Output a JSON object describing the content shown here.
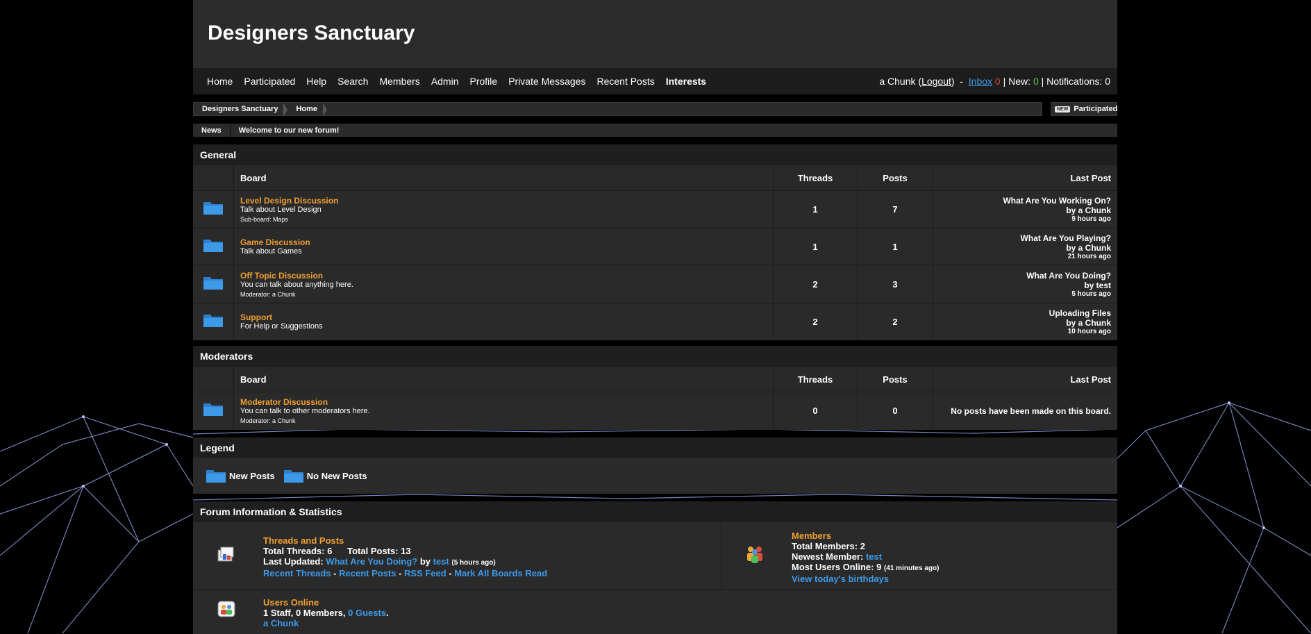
{
  "site": {
    "title": "Designers Sanctuary"
  },
  "nav": {
    "items": [
      "Home",
      "Participated",
      "Help",
      "Search",
      "Members",
      "Admin",
      "Profile",
      "Private Messages",
      "Recent Posts",
      "Interests"
    ]
  },
  "user": {
    "name": "a Chunk",
    "logout": "Logout",
    "inbox_label": "Inbox",
    "inbox_count": "0",
    "new_label": "New:",
    "new_count": "0",
    "notifications_label": "Notifications:",
    "notifications_count": "0"
  },
  "breadcrumb": [
    "Designers Sanctuary",
    "Home"
  ],
  "participated_button": {
    "tag": "NEW",
    "label": "Participated"
  },
  "news": {
    "label": "News",
    "text": "Welcome to our new forum!"
  },
  "general": {
    "title": "General",
    "headers": {
      "board": "Board",
      "threads": "Threads",
      "posts": "Posts",
      "last": "Last Post"
    },
    "boards": [
      {
        "name": "Level Design Discussion",
        "desc": "Talk about Level Design",
        "sub": "Sub-board: Maps",
        "threads": "1",
        "posts": "7",
        "last_title": "What Are You Working On?",
        "last_by": "by a Chunk",
        "last_time": "9 hours ago"
      },
      {
        "name": "Game Discussion",
        "desc": "Talk about Games",
        "sub": "",
        "threads": "1",
        "posts": "1",
        "last_title": "What Are You Playing?",
        "last_by": "by a Chunk",
        "last_time": "21 hours ago"
      },
      {
        "name": "Off Topic Discussion",
        "desc": "You can talk about anything here.",
        "sub": "Moderator: a Chunk",
        "threads": "2",
        "posts": "3",
        "last_title": "What Are You Doing?",
        "last_by": "by test",
        "last_time": "5 hours ago"
      },
      {
        "name": "Support",
        "desc": "For Help or Suggestions",
        "sub": "",
        "threads": "2",
        "posts": "2",
        "last_title": "Uploading Files",
        "last_by": "by a Chunk",
        "last_time": "10 hours ago"
      }
    ]
  },
  "moderators": {
    "title": "Moderators",
    "headers": {
      "board": "Board",
      "threads": "Threads",
      "posts": "Posts",
      "last": "Last Post"
    },
    "boards": [
      {
        "name": "Moderator Discussion",
        "desc": "You can talk to other moderators here.",
        "sub": "Moderator: a Chunk",
        "threads": "0",
        "posts": "0",
        "last_text": "No posts have been made on this board."
      }
    ]
  },
  "legend": {
    "title": "Legend",
    "new_posts": "New Posts",
    "no_new_posts": "No New Posts"
  },
  "stats": {
    "title": "Forum Information & Statistics",
    "threads_posts": {
      "heading": "Threads and Posts",
      "total_threads_label": "Total Threads:",
      "total_threads": "6",
      "total_posts_label": "Total Posts:",
      "total_posts": "13",
      "last_updated_label": "Last Updated:",
      "last_updated_thread": "What Are You Doing?",
      "by": "by",
      "last_updated_user": "test",
      "last_updated_time": "(5 hours ago)",
      "links": [
        "Recent Threads",
        "Recent Posts",
        "RSS Feed",
        "Mark All Boards Read"
      ]
    },
    "members": {
      "heading": "Members",
      "total_label": "Total Members:",
      "total": "2",
      "newest_label": "Newest Member:",
      "newest": "test",
      "most_online_label": "Most Users Online:",
      "most_online": "9",
      "most_online_time": "(41 minutes ago)",
      "birthdays": "View today's birthdays"
    },
    "online": {
      "heading": "Users Online",
      "summary_a": "1 Staff, 0 Members,",
      "guests": "0 Guests",
      "summary_end": ".",
      "user": "a Chunk"
    }
  },
  "colors": {
    "accent_orange": "#f0a030",
    "link_blue": "#3d9ae8",
    "folder_blue": "#3d9ae8"
  }
}
